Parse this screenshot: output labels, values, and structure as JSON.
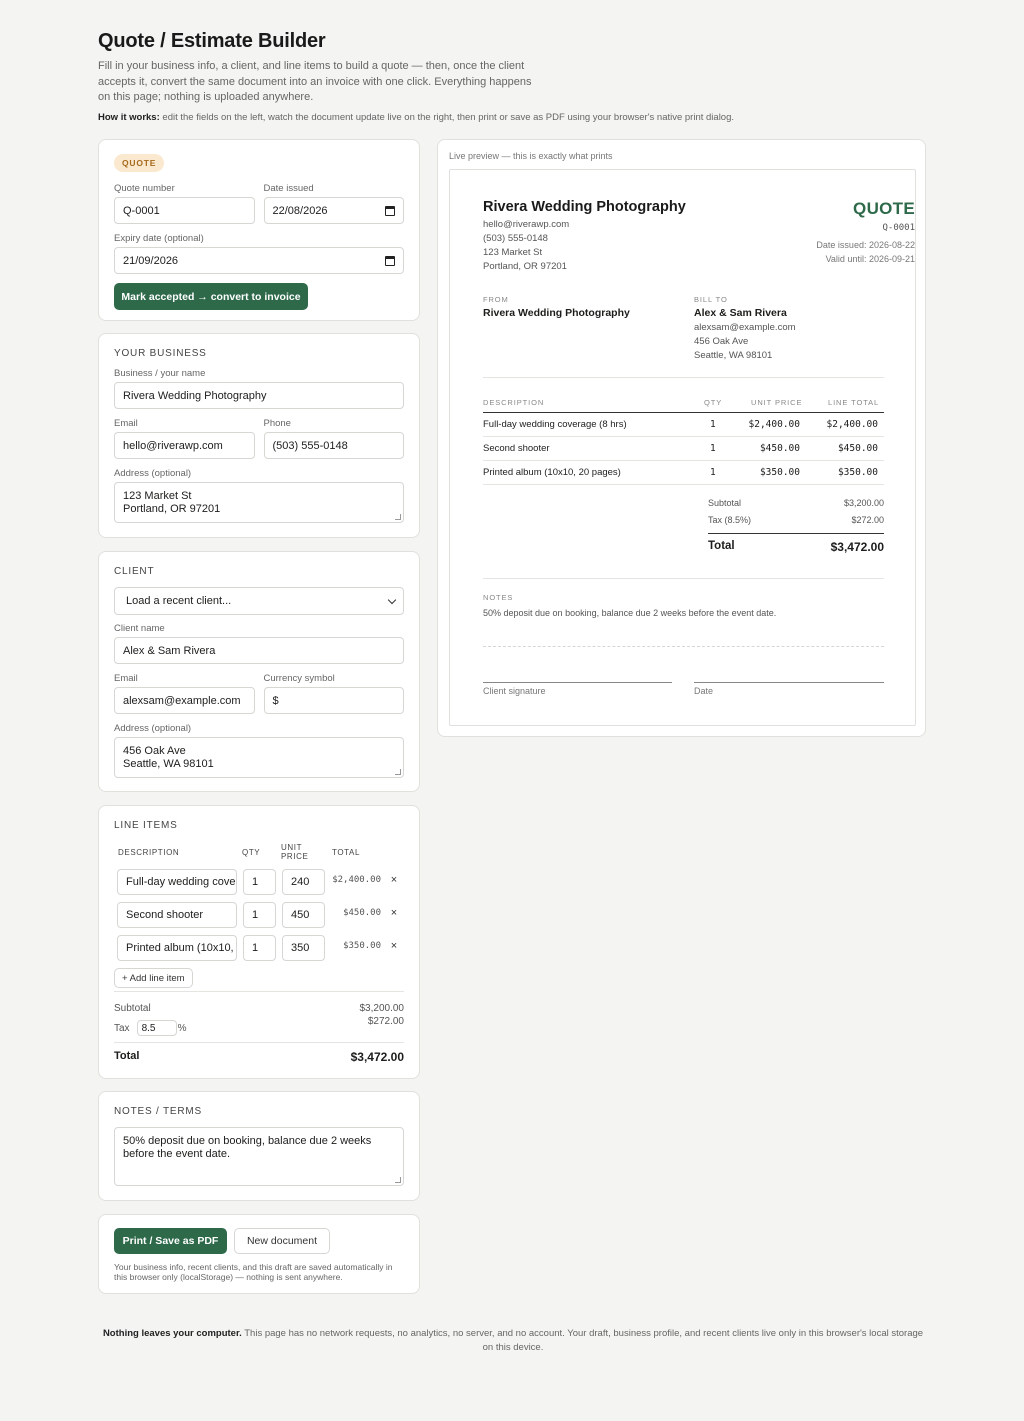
{
  "header": {
    "title": "Quote / Estimate Builder",
    "intro": "Fill in your business info, a client, and line items to build a quote — then, once the client accepts it, convert the same document into an invoice with one click. Everything happens on this page; nothing is uploaded anywhere.",
    "how_label": "How it works:",
    "how_text": " edit the fields on the left, watch the document update live on the right, then print or save as PDF using your browser's native print dialog."
  },
  "quote_card": {
    "badge": "QUOTE",
    "number_label": "Quote number",
    "number_value": "Q-0001",
    "date_label": "Date issued",
    "date_value": "22/08/2026",
    "expiry_label": "Expiry date (optional)",
    "expiry_value": "21/09/2026",
    "convert_button": "Mark accepted → convert to invoice"
  },
  "business": {
    "title": "YOUR BUSINESS",
    "name_label": "Business / your name",
    "name_value": "Rivera Wedding Photography",
    "email_label": "Email",
    "email_value": "hello@riverawp.com",
    "phone_label": "Phone",
    "phone_value": "(503) 555-0148",
    "address_label": "Address (optional)",
    "address_value": "123 Market St\nPortland, OR 97201"
  },
  "client": {
    "title": "CLIENT",
    "recent_select": "Load a recent client...",
    "name_label": "Client name",
    "name_value": "Alex & Sam Rivera",
    "email_label": "Email",
    "email_value": "alexsam@example.com",
    "currency_label": "Currency symbol",
    "currency_value": "$",
    "address_label": "Address (optional)",
    "address_value": "456 Oak Ave\nSeattle, WA 98101"
  },
  "line_items": {
    "title": "LINE ITEMS",
    "col_description": "DESCRIPTION",
    "col_qty": "QTY",
    "col_unit_price": "UNIT\nPRICE",
    "col_total": "TOTAL",
    "rows": [
      {
        "description": "Full-day wedding cove",
        "qty": "1",
        "unit_price": "240",
        "total": "$2,400.00"
      },
      {
        "description": "Second shooter",
        "qty": "1",
        "unit_price": "450",
        "total": "$450.00"
      },
      {
        "description": "Printed album (10x10,",
        "qty": "1",
        "unit_price": "350",
        "total": "$350.00"
      }
    ],
    "add_button": "+ Add line item",
    "subtotal_label": "Subtotal",
    "subtotal_value": "$3,200.00",
    "tax_label": "Tax",
    "tax_rate": "8.5",
    "tax_pct": "%",
    "tax_value": "$272.00",
    "total_label": "Total",
    "total_value": "$3,472.00"
  },
  "notes": {
    "title": "NOTES / TERMS",
    "value": "50% deposit due on booking, balance due 2 weeks\nbefore the event date."
  },
  "actions": {
    "print_button": "Print / Save as PDF",
    "new_button": "New document",
    "storage_note": "Your business info, recent clients, and this draft are saved automatically in this browser only (localStorage) — nothing is sent anywhere."
  },
  "preview": {
    "caption": "Live preview — this is exactly what prints",
    "business_name": "Rivera Wedding Photography",
    "business_email": "hello@riverawp.com",
    "business_phone": "(503) 555-0148",
    "business_addr1": "123 Market St",
    "business_addr2": "Portland, OR 97201",
    "doc_type": "QUOTE",
    "doc_number": "Q-0001",
    "date_issued": "Date issued: 2026-08-22",
    "valid_until": "Valid until: 2026-09-21",
    "from_label": "FROM",
    "from_name": "Rivera Wedding Photography",
    "bill_label": "BILL TO",
    "bill_name": "Alex & Sam Rivera",
    "bill_email": "alexsam@example.com",
    "bill_addr1": "456 Oak Ave",
    "bill_addr2": "Seattle, WA 98101",
    "col_description": "DESCRIPTION",
    "col_qty": "QTY",
    "col_unit": "UNIT PRICE",
    "col_line_total": "LINE TOTAL",
    "items": [
      {
        "description": "Full-day wedding coverage (8 hrs)",
        "qty": "1",
        "unit": "$2,400.00",
        "total": "$2,400.00"
      },
      {
        "description": "Second shooter",
        "qty": "1",
        "unit": "$450.00",
        "total": "$450.00"
      },
      {
        "description": "Printed album (10x10, 20 pages)",
        "qty": "1",
        "unit": "$350.00",
        "total": "$350.00"
      }
    ],
    "subtotal_label": "Subtotal",
    "subtotal_value": "$3,200.00",
    "tax_label": "Tax (8.5%)",
    "tax_value": "$272.00",
    "total_label": "Total",
    "total_value": "$3,472.00",
    "notes_label": "NOTES",
    "notes_text": "50% deposit due on booking, balance due 2 weeks before the event date.",
    "sig_label": "Client signature",
    "date_label": "Date"
  },
  "footer": {
    "bold": "Nothing leaves your computer.",
    "text": " This page has no network requests, no analytics, no server, and no account. Your draft, business profile, and recent clients live only in this browser's local storage on this device."
  },
  "colors": {
    "accent": "#2e6a4a",
    "badge_bg": "#fbe9cf",
    "badge_text": "#a5691c",
    "page_bg": "#f4f4f2"
  }
}
